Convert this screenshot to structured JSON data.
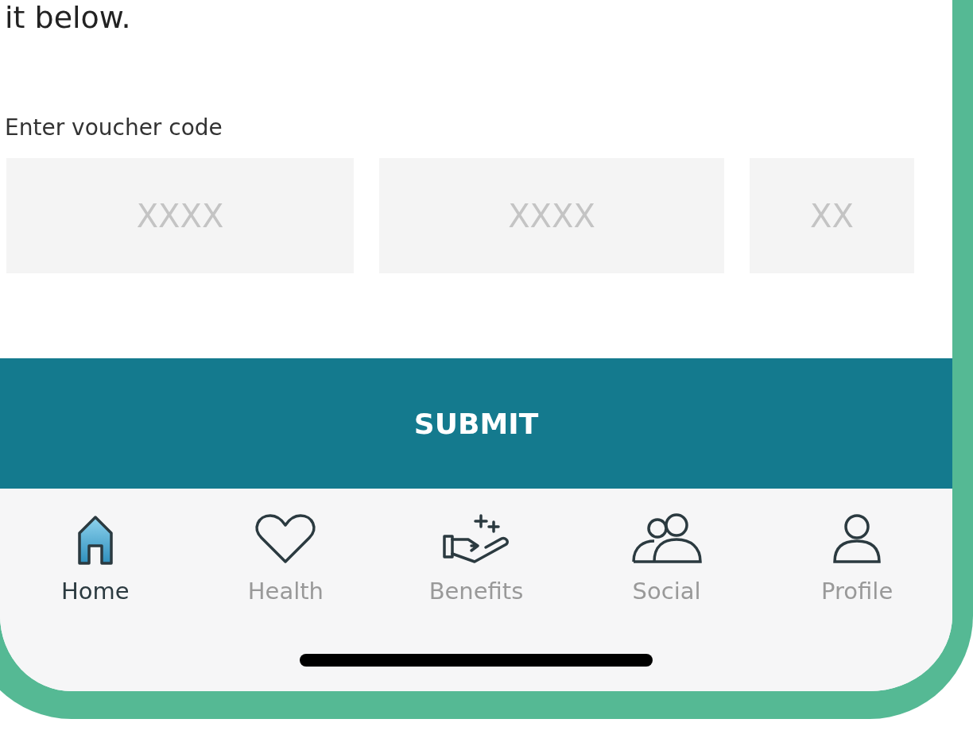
{
  "intro_text": "it below.",
  "voucher": {
    "label": "Enter voucher code",
    "fields": [
      {
        "placeholder": "XXXX"
      },
      {
        "placeholder": "XXXX"
      },
      {
        "placeholder": "XX"
      }
    ]
  },
  "submit_button": "SUBMIT",
  "tabs": [
    {
      "label": "Home",
      "selected": true
    },
    {
      "label": "Health",
      "selected": false
    },
    {
      "label": "Benefits",
      "selected": false
    },
    {
      "label": "Social",
      "selected": false
    },
    {
      "label": "Profile",
      "selected": false
    }
  ]
}
